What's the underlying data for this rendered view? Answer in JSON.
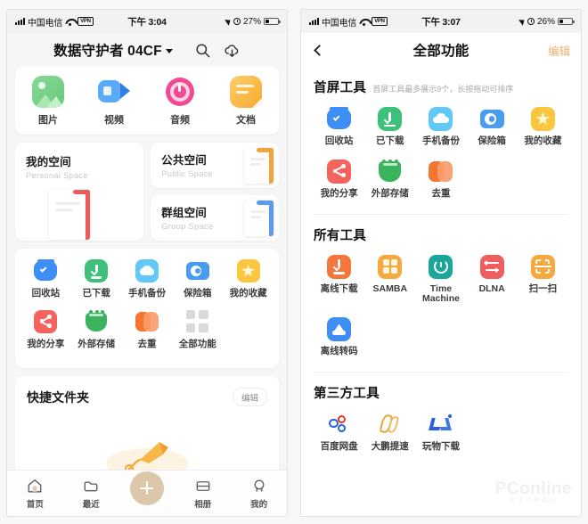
{
  "left": {
    "status": {
      "carrier": "中国电信",
      "vpn": "VPN",
      "time": "下午 3:04",
      "battery": "27%"
    },
    "nav": {
      "title": "数据守护者 04CF",
      "search_icon": "search-icon",
      "cloud_icon": "cloud-download-icon"
    },
    "categories": [
      {
        "label": "图片",
        "icon": "picture-icon",
        "color": "#7fd18a"
      },
      {
        "label": "视频",
        "icon": "video-icon",
        "color": "#4da2f5"
      },
      {
        "label": "音频",
        "icon": "audio-icon",
        "color": "#ef4e92"
      },
      {
        "label": "文档",
        "icon": "document-icon",
        "color": "#f9b73e"
      }
    ],
    "spaces": [
      {
        "title": "我的空间",
        "subtitle": "Personal Space",
        "color": "#ef5a5a"
      },
      {
        "title": "公共空间",
        "subtitle": "Public Space",
        "color": "#f2a43c"
      },
      {
        "title": "群组空间",
        "subtitle": "Group Space",
        "color": "#5a9bf0"
      }
    ],
    "tools": [
      {
        "label": "回收站",
        "icon": "recycle-bin-icon",
        "color": "#3d8ef5"
      },
      {
        "label": "已下载",
        "icon": "downloaded-icon",
        "color": "#3cc07a"
      },
      {
        "label": "手机备份",
        "icon": "phone-backup-icon",
        "color": "#61c8f7"
      },
      {
        "label": "保险箱",
        "icon": "safe-box-icon",
        "color": "#4a9cf0"
      },
      {
        "label": "我的收藏",
        "icon": "favorites-icon",
        "color": "#fbc63f"
      },
      {
        "label": "我的分享",
        "icon": "my-share-icon",
        "color": "#f4635e"
      },
      {
        "label": "外部存储",
        "icon": "external-storage-icon",
        "color": "#3ab35c"
      },
      {
        "label": "去重",
        "icon": "dedupe-icon",
        "color": "#f4762e"
      },
      {
        "label": "全部功能",
        "icon": "all-functions-icon",
        "color": "#d9d9de"
      }
    ],
    "quick": {
      "title": "快捷文件夹",
      "edit_label": "编辑"
    },
    "tabs": [
      {
        "label": "首页",
        "icon": "home-icon"
      },
      {
        "label": "最近",
        "icon": "recent-folder-icon"
      },
      {
        "label": "",
        "icon": "add-icon"
      },
      {
        "label": "相册",
        "icon": "album-icon"
      },
      {
        "label": "我的",
        "icon": "profile-icon"
      }
    ]
  },
  "right": {
    "status": {
      "carrier": "中国电信",
      "vpn": "VPN",
      "time": "下午 3:07",
      "battery": "26%"
    },
    "nav": {
      "back_icon": "back-chevron-icon",
      "title": "全部功能",
      "edit_label": "编辑"
    },
    "sections": [
      {
        "title": "首屏工具",
        "subtitle": "首屏工具最多展示9个，长按拖动可排序",
        "items": [
          {
            "label": "回收站",
            "icon": "recycle-bin-icon",
            "color": "#3d8ef5"
          },
          {
            "label": "已下载",
            "icon": "downloaded-icon",
            "color": "#3cc07a"
          },
          {
            "label": "手机备份",
            "icon": "phone-backup-icon",
            "color": "#61c8f7"
          },
          {
            "label": "保险箱",
            "icon": "safe-box-icon",
            "color": "#4a9cf0"
          },
          {
            "label": "我的收藏",
            "icon": "favorites-icon",
            "color": "#fbc63f"
          },
          {
            "label": "我的分享",
            "icon": "my-share-icon",
            "color": "#f4635e"
          },
          {
            "label": "外部存储",
            "icon": "external-storage-icon",
            "color": "#3ab35c"
          },
          {
            "label": "去重",
            "icon": "dedupe-icon",
            "color": "#f4762e"
          }
        ]
      },
      {
        "title": "所有工具",
        "subtitle": "",
        "items": [
          {
            "label": "离线下载",
            "icon": "offline-download-icon",
            "color": "#f4763b"
          },
          {
            "label": "SAMBA",
            "icon": "samba-icon",
            "color": "#f5a93e"
          },
          {
            "label": "Time Machine",
            "icon": "time-machine-icon",
            "color": "#1aa79a"
          },
          {
            "label": "DLNA",
            "icon": "dlna-icon",
            "color": "#ef5e5e"
          },
          {
            "label": "扫一扫",
            "icon": "scan-icon",
            "color": "#f5a93e"
          },
          {
            "label": "离线转码",
            "icon": "offline-transcode-icon",
            "color": "#3d8ef5"
          }
        ]
      },
      {
        "title": "第三方工具",
        "subtitle": "",
        "items": [
          {
            "label": "百度网盘",
            "icon": "baidu-netdisk-icon",
            "color": "#2a5de0"
          },
          {
            "label": "大鹏提速",
            "icon": "dapeng-speedup-icon",
            "color": "#e8a33c"
          },
          {
            "label": "玩物下载",
            "icon": "wanwu-download-icon",
            "color": "#2a5de0"
          }
        ]
      }
    ],
    "watermark": {
      "text": "PConline",
      "sub": "太平洋电脑网"
    }
  }
}
